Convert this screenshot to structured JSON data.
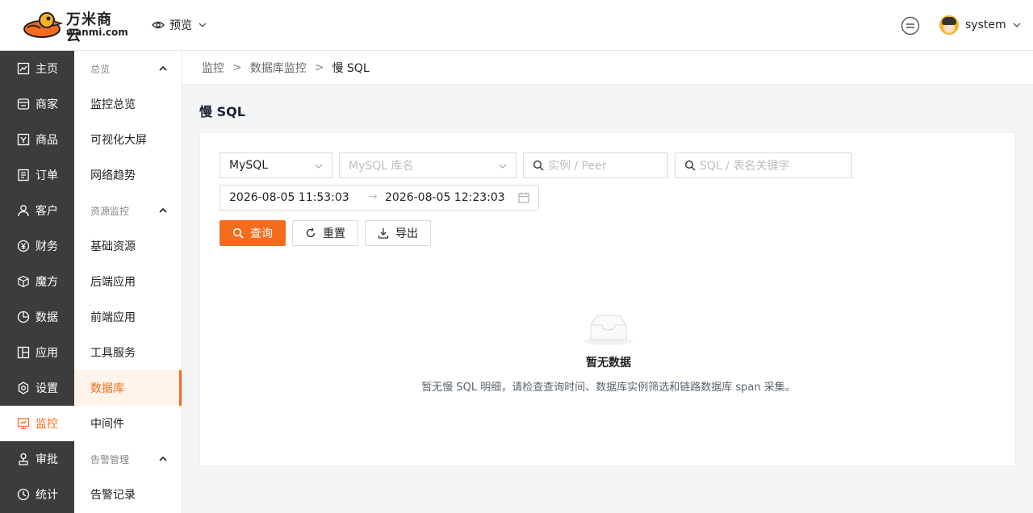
{
  "header": {
    "brand_cn": "万米商云",
    "brand_en": "wanmi.com",
    "preview_label": "预览",
    "user_name": "system"
  },
  "leftnav": [
    {
      "label": "主页",
      "icon": "dashboard-icon"
    },
    {
      "label": "商家",
      "icon": "store-icon"
    },
    {
      "label": "商品",
      "icon": "goods-icon"
    },
    {
      "label": "订单",
      "icon": "order-icon"
    },
    {
      "label": "客户",
      "icon": "user-icon"
    },
    {
      "label": "财务",
      "icon": "yen-icon"
    },
    {
      "label": "魔方",
      "icon": "cube-icon"
    },
    {
      "label": "数据",
      "icon": "pie-icon"
    },
    {
      "label": "应用",
      "icon": "app-icon"
    },
    {
      "label": "设置",
      "icon": "gear-icon"
    },
    {
      "label": "监控",
      "icon": "monitor-icon",
      "active": true
    },
    {
      "label": "审批",
      "icon": "approve-icon"
    },
    {
      "label": "统计",
      "icon": "stats-icon"
    }
  ],
  "subnav": {
    "group_overview": "总览",
    "overview_items": [
      "监控总览",
      "可视化大屏",
      "网络趋势"
    ],
    "group_resource": "资源监控",
    "resource_items": [
      "基础资源",
      "后端应用",
      "前端应用",
      "工具服务",
      "数据库",
      "中间件"
    ],
    "active_item": "数据库",
    "group_alert": "告警管理",
    "alert_items": [
      "告警记录"
    ]
  },
  "breadcrumb": [
    "监控",
    "数据库监控",
    "慢 SQL"
  ],
  "page_title": "慢 SQL",
  "filters": {
    "db_type": "MySQL",
    "db_name_placeholder": "MySQL 库名",
    "instance_placeholder": "实例 / Peer",
    "sql_placeholder": "SQL / 表名关键字",
    "date_start": "2026-08-05 11:53:03",
    "date_sep": "→",
    "date_end": "2026-08-05 12:23:03"
  },
  "buttons": {
    "query": "查询",
    "reset": "重置",
    "export": "导出"
  },
  "empty": {
    "title": "暂无数据",
    "desc": "暂无慢 SQL 明细，请检查查询时间、数据库实例筛选和链路数据库 span 采集。"
  },
  "colors": {
    "accent": "#f56c1d",
    "nav_bg": "#3c3c3c"
  }
}
